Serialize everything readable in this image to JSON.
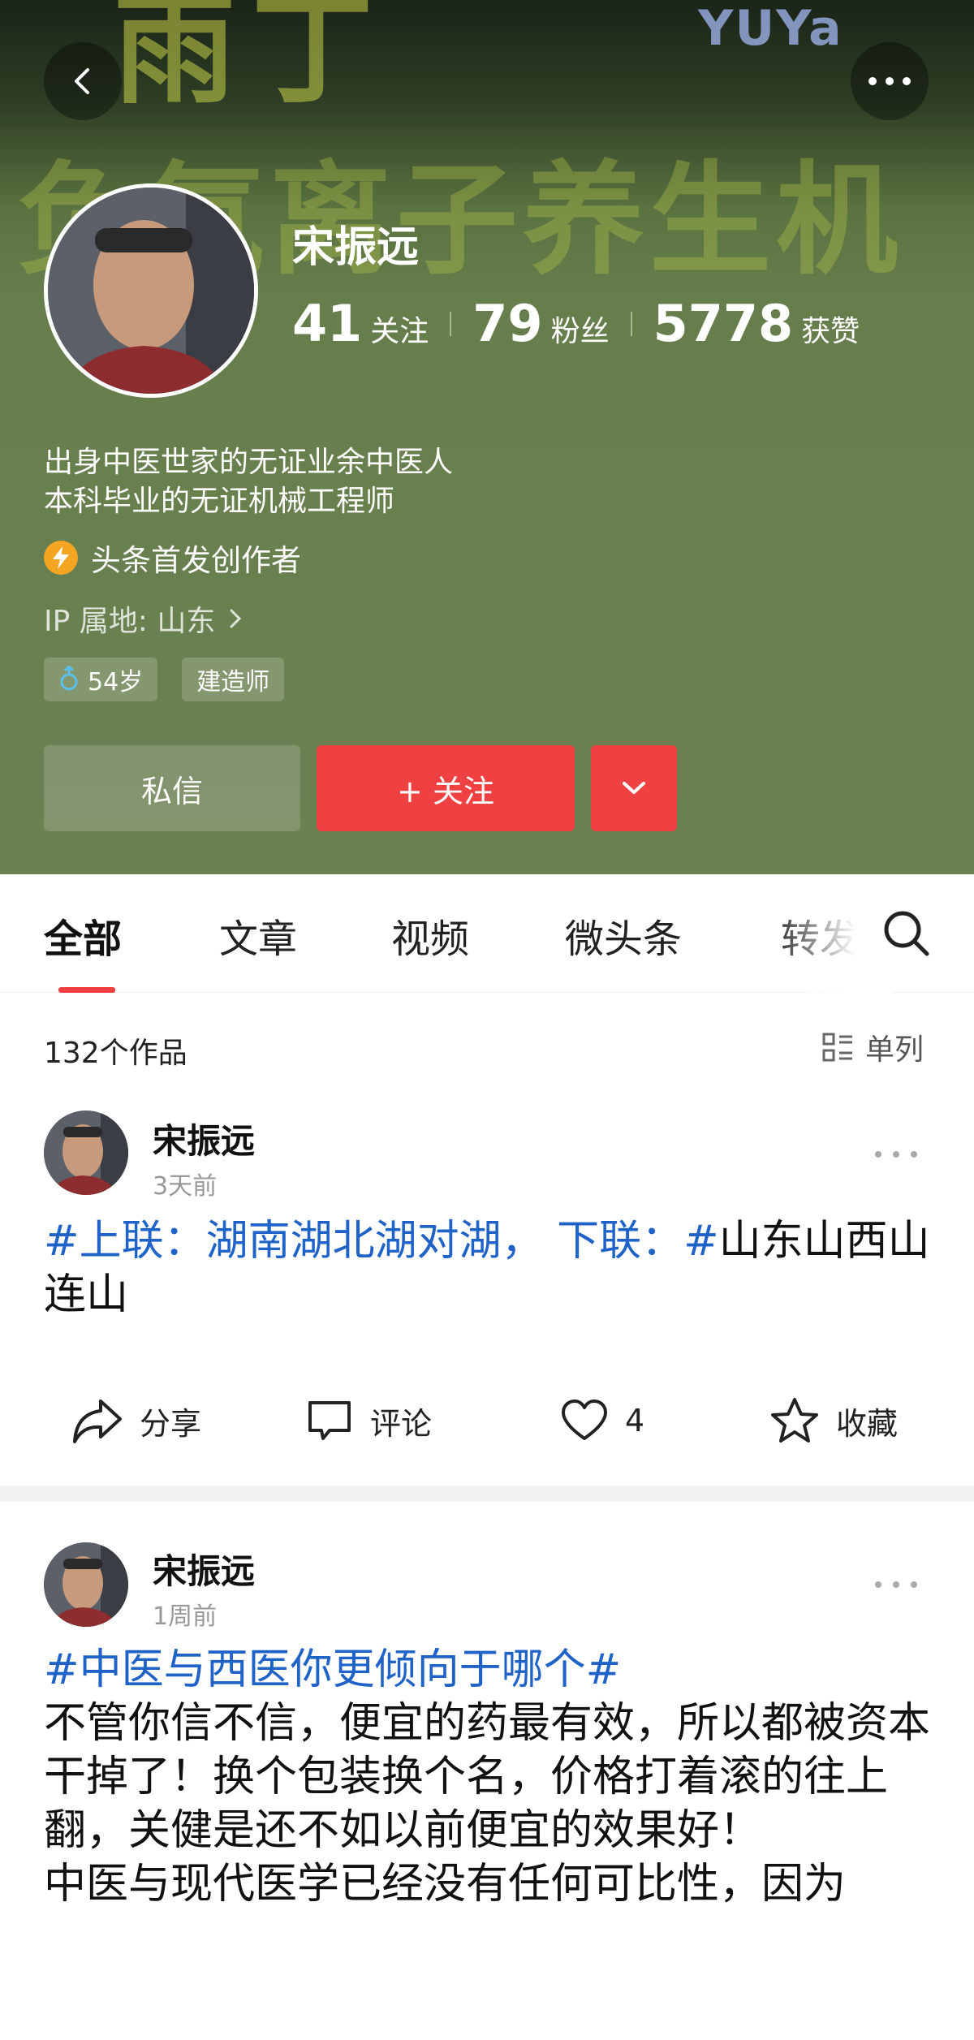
{
  "header": {
    "bg_text_line1": "雨丁",
    "bg_text_line2": "负氧离子养生机",
    "bg_brand": "YUYa",
    "name": "宋振远",
    "stats": [
      {
        "num": "41",
        "label": "关注"
      },
      {
        "num": "79",
        "label": "粉丝"
      },
      {
        "num": "5778",
        "label": "获赞"
      }
    ],
    "bio_line1": "出身中医世家的无证业余中医人",
    "bio_line2": "本科毕业的无证机械工程师",
    "creator_label": "头条首发创作者",
    "ip_label": "IP 属地: 山东",
    "tags": [
      {
        "icon": "male-icon",
        "label": "54岁"
      },
      {
        "label": "建造师"
      }
    ],
    "dm_button": "私信",
    "follow_button": "+ 关注",
    "accent_color": "#f04142"
  },
  "tabs": [
    {
      "label": "全部",
      "active": true
    },
    {
      "label": "文章"
    },
    {
      "label": "视频"
    },
    {
      "label": "微头条"
    },
    {
      "label": "转发"
    }
  ],
  "list": {
    "count": "132个作品",
    "view_toggle": "单列"
  },
  "posts": [
    {
      "author": "宋振远",
      "time": "3天前",
      "hashtag": "#上联：湖南湖北湖对湖，  下联：#",
      "text": "山东山西山连山",
      "actions": {
        "share": "分享",
        "comment": "评论",
        "like_count": "4",
        "favorite": "收藏"
      }
    },
    {
      "author": "宋振远",
      "time": "1周前",
      "hashtag": "#中医与西医你更倾向于哪个#",
      "text": "不管你信不信，便宜的药最有效，所以都被资本干掉了！换个包装换个名，价格打着滚的往上翻，关健是还不如以前便宜的效果好！",
      "text2": "中医与现代医学已经没有任何可比性，因为"
    }
  ],
  "hashtag_color": "#1f63c8"
}
